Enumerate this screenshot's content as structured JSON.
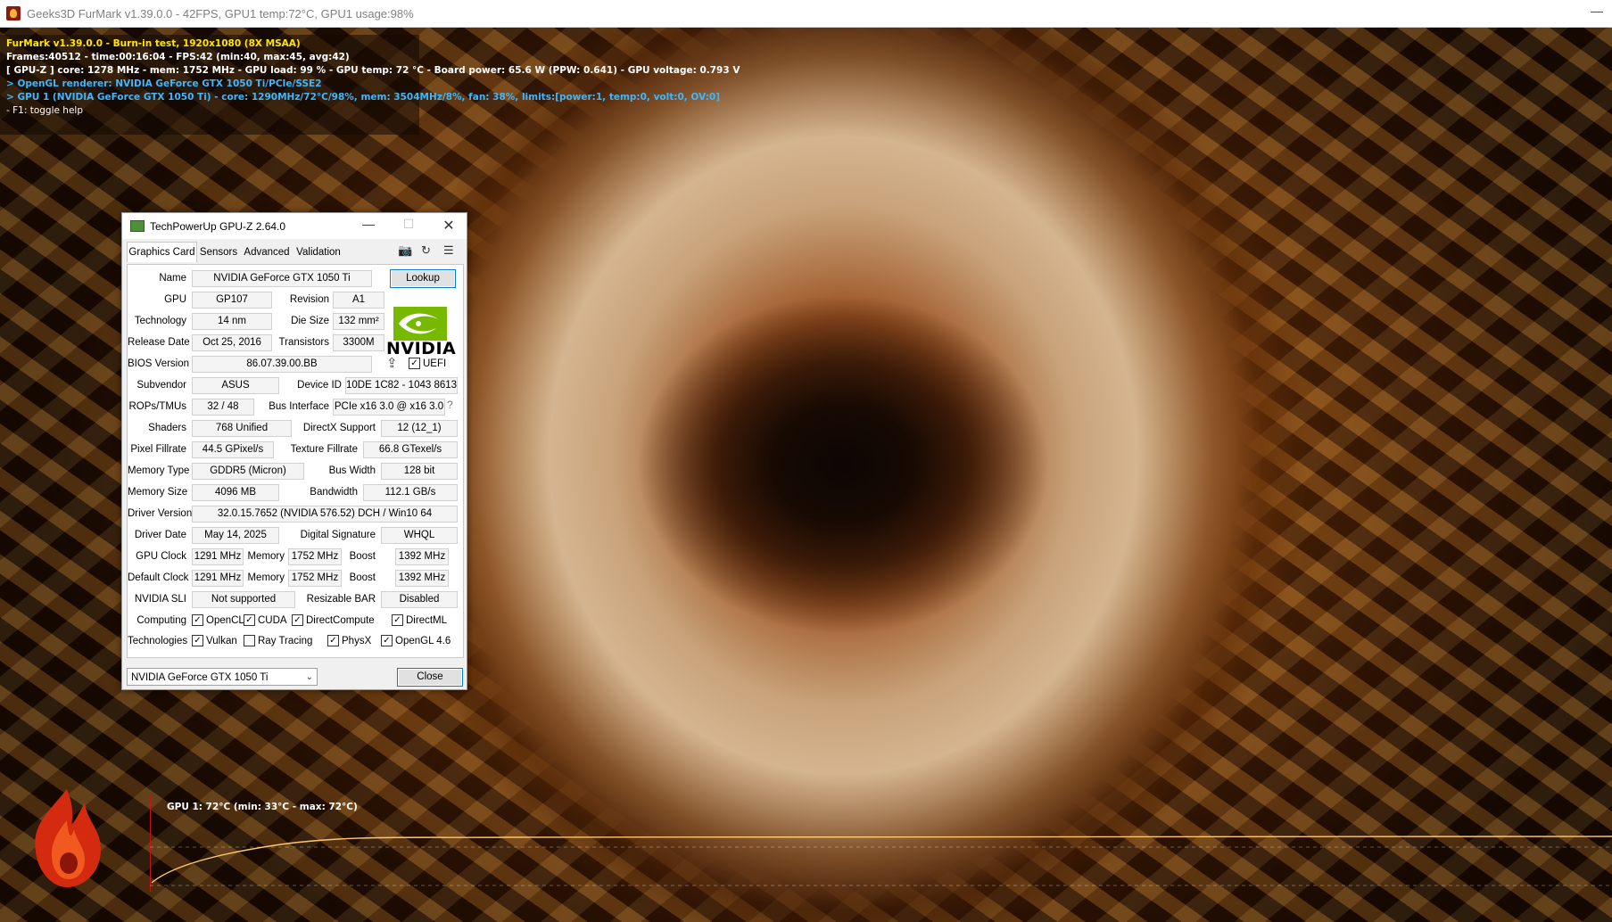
{
  "window": {
    "title": "Geeks3D FurMark v1.39.0.0 - 42FPS, GPU1 temp:72°C, GPU1 usage:98%",
    "min_glyph": "—"
  },
  "overlay": {
    "line1": "FurMark v1.39.0.0 - Burn-in test, 1920x1080 (8X MSAA)",
    "line2": "Frames:40512 - time:00:16:04 - FPS:42 (min:40, max:45, avg:42)",
    "line3": "[ GPU-Z ] core: 1278 MHz - mem: 1752 MHz - GPU load: 99 % - GPU temp: 72 °C - Board power: 65.6 W (PPW: 0.641) - GPU voltage: 0.793 V",
    "line4": "> OpenGL renderer: NVIDIA GeForce GTX 1050 Ti/PCIe/SSE2",
    "line5": "> GPU 1 (NVIDIA GeForce GTX 1050 Ti) - core: 1290MHz/72°C/98%, mem: 3504MHz/8%, fan: 38%, limits:[power:1, temp:0, volt:0, OV:0]",
    "line6": "- F1: toggle help",
    "graph_label": "GPU 1: 72°C (min: 33°C - max: 72°C)"
  },
  "gpuz": {
    "title": "TechPowerUp GPU-Z 2.64.0",
    "min_glyph": "—",
    "max_glyph": "☐",
    "close_glyph": "✕",
    "tabs": [
      "Graphics Card",
      "Sensors",
      "Advanced",
      "Validation"
    ],
    "camera_glyph": "📷",
    "refresh_glyph": "↻",
    "menu_glyph": "☰",
    "labels": {
      "name": "Name",
      "gpu": "GPU",
      "revision": "Revision",
      "technology": "Technology",
      "die_size": "Die Size",
      "release_date": "Release Date",
      "transistors": "Transistors",
      "bios_version": "BIOS Version",
      "uefi": "UEFI",
      "subvendor": "Subvendor",
      "device_id": "Device ID",
      "rops_tmus": "ROPs/TMUs",
      "bus_interface": "Bus Interface",
      "shaders": "Shaders",
      "directx_support": "DirectX Support",
      "pixel_fillrate": "Pixel Fillrate",
      "texture_fillrate": "Texture Fillrate",
      "memory_type": "Memory Type",
      "bus_width": "Bus Width",
      "memory_size": "Memory Size",
      "bandwidth": "Bandwidth",
      "driver_version": "Driver Version",
      "driver_date": "Driver Date",
      "digital_signature": "Digital Signature",
      "gpu_clock": "GPU Clock",
      "memory": "Memory",
      "boost": "Boost",
      "default_clock": "Default Clock",
      "nvidia_sli": "NVIDIA SLI",
      "resizable_bar": "Resizable BAR",
      "computing": "Computing",
      "technologies": "Technologies"
    },
    "values": {
      "name": "NVIDIA GeForce GTX 1050 Ti",
      "gpu": "GP107",
      "revision": "A1",
      "technology": "14 nm",
      "die_size": "132 mm²",
      "release_date": "Oct 25, 2016",
      "transistors": "3300M",
      "bios_version": "86.07.39.00.BB",
      "subvendor": "ASUS",
      "device_id": "10DE 1C82 - 1043 8613",
      "rops_tmus": "32 / 48",
      "bus_interface": "PCIe x16 3.0 @ x16 3.0",
      "bus_help": "?",
      "shaders": "768 Unified",
      "directx_support": "12 (12_1)",
      "pixel_fillrate": "44.5 GPixel/s",
      "texture_fillrate": "66.8 GTexel/s",
      "memory_type": "GDDR5 (Micron)",
      "bus_width": "128 bit",
      "memory_size": "4096 MB",
      "bandwidth": "112.1 GB/s",
      "driver_version": "32.0.15.7652 (NVIDIA 576.52) DCH / Win10 64",
      "driver_date": "May 14, 2025",
      "digital_signature": "WHQL",
      "gpu_clock": "1291 MHz",
      "gpu_memory": "1752 MHz",
      "gpu_boost": "1392 MHz",
      "default_clock": "1291 MHz",
      "default_memory": "1752 MHz",
      "default_boost": "1392 MHz",
      "nvidia_sli": "Not supported",
      "resizable_bar": "Disabled"
    },
    "lookup_label": "Lookup",
    "share_glyph": "⇪",
    "vendor_logo_text": "NVIDIA",
    "check": "✓",
    "computing": [
      {
        "label": "OpenCL",
        "checked": true
      },
      {
        "label": "CUDA",
        "checked": true
      },
      {
        "label": "DirectCompute",
        "checked": true
      },
      {
        "label": "DirectML",
        "checked": true
      }
    ],
    "technologies": [
      {
        "label": "Vulkan",
        "checked": true
      },
      {
        "label": "Ray Tracing",
        "checked": false
      },
      {
        "label": "PhysX",
        "checked": true
      },
      {
        "label": "OpenGL 4.6",
        "checked": true
      }
    ],
    "uefi_checked": true,
    "gpu_select": "NVIDIA GeForce GTX 1050 Ti",
    "select_chevron": "⌄",
    "close_label": "Close"
  }
}
